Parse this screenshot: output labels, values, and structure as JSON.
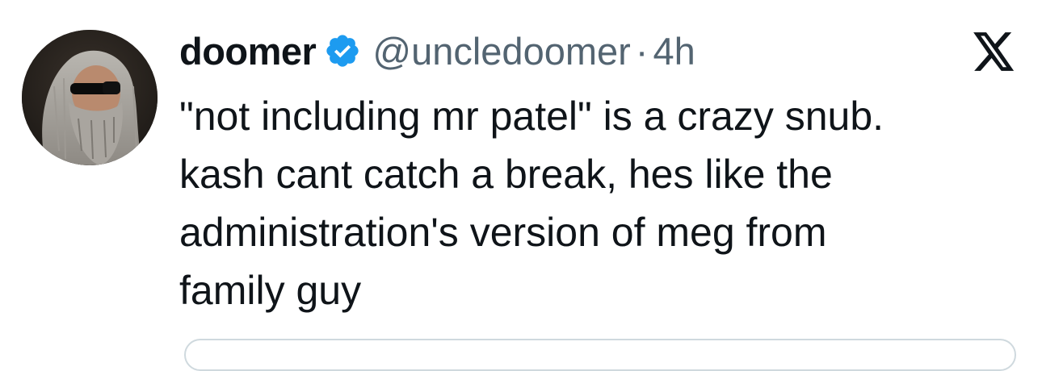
{
  "tweet": {
    "author": {
      "display_name": "doomer",
      "handle": "@uncledoomer",
      "verified": true,
      "verified_color": "#1d9bf0"
    },
    "separator": "·",
    "time": "4h",
    "text": "\"not including mr patel\" is a crazy snub.\nkash cant catch a break, hes like the\nadministration's version of meg from\nfamily guy",
    "platform_icon": "x-logo-icon"
  },
  "colors": {
    "text_primary": "#0f1419",
    "text_secondary": "#536471",
    "border": "#cfd9de",
    "background": "#ffffff"
  }
}
